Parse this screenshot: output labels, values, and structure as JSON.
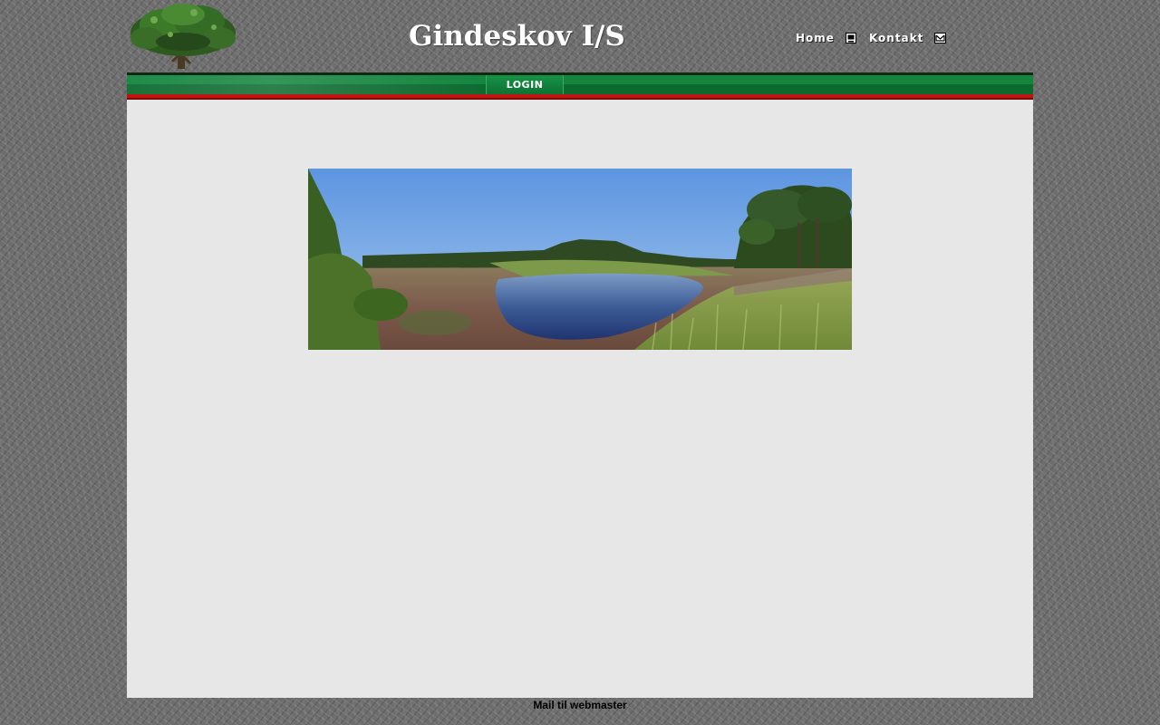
{
  "header": {
    "title": "Gindeskov I/S",
    "logo_icon": "tree-logo-icon"
  },
  "topnav": {
    "home_label": "Home",
    "home_icon": "computer-icon",
    "contact_label": "Kontakt",
    "contact_icon": "envelope-icon"
  },
  "navbar": {
    "login_label": "LOGIN"
  },
  "hero": {
    "subject": "heath-lake-landscape-photo"
  },
  "footer": {
    "mail_link": "Mail til webmaster"
  },
  "colors": {
    "nav_green": "#13853f",
    "nav_red": "#c2140f",
    "content_bg": "#e7e7e7",
    "page_texture": "#6e6e6e"
  }
}
